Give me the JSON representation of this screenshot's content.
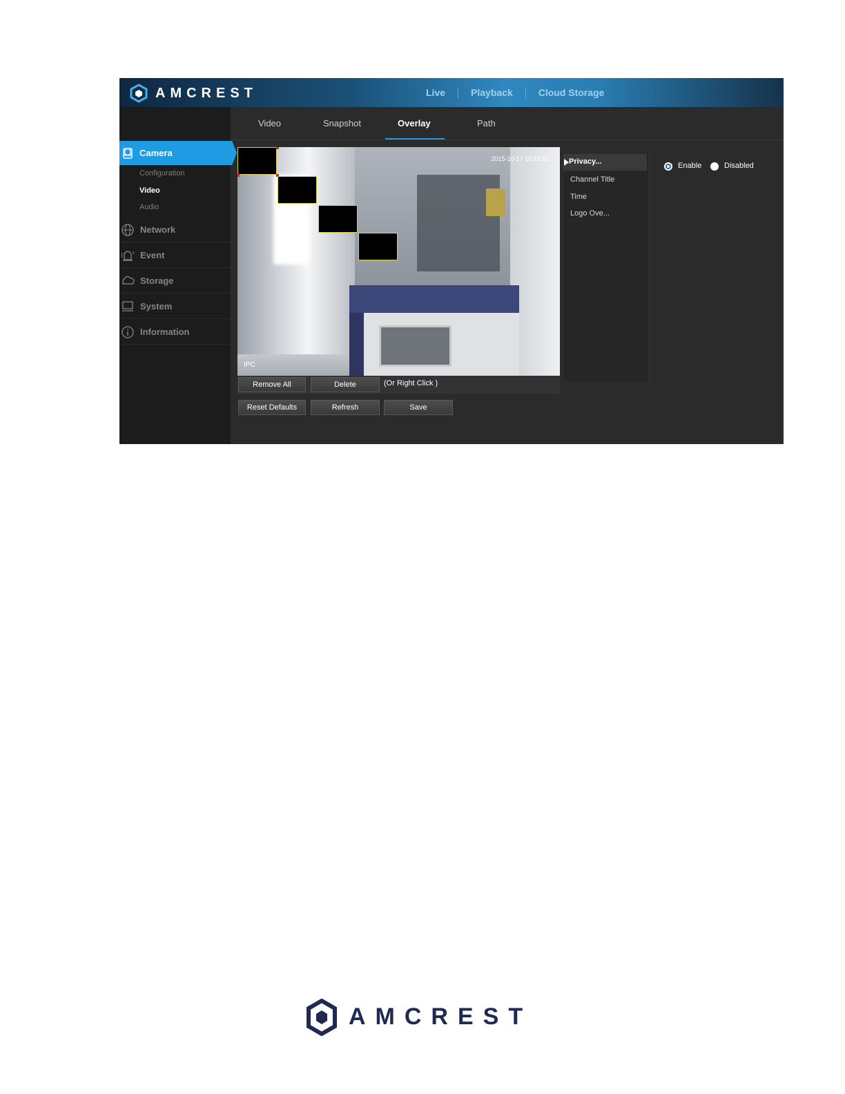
{
  "header": {
    "brand": "AMCREST",
    "nav": [
      "Live",
      "Playback",
      "Cloud Storage"
    ]
  },
  "sidebar": {
    "active": "Camera",
    "sub_items": [
      "Configuration",
      "Video",
      "Audio"
    ],
    "active_sub": "Video",
    "items": [
      "Network",
      "Event",
      "Storage",
      "System",
      "Information"
    ]
  },
  "tabs": [
    "Video",
    "Snapshot",
    "Overlay",
    "Path"
  ],
  "active_tab": "Overlay",
  "video": {
    "timestamp": "2015-10-17 10:22:31",
    "channel_label": "IPC"
  },
  "buttons": {
    "remove_all": "Remove All",
    "delete": "Delete",
    "hint": "(Or Right Click )",
    "reset_defaults": "Reset Defaults",
    "refresh": "Refresh",
    "save": "Save"
  },
  "overlay_menu": {
    "active": "Privacy...",
    "items": [
      "Channel Title",
      "Time",
      "Logo Ove..."
    ]
  },
  "privacy": {
    "enable_label": "Enable",
    "disabled_label": "Disabled",
    "selected": "Enable"
  },
  "footer": {
    "brand": "AMCREST"
  },
  "colors": {
    "accent": "#1e9be3",
    "brand_dark": "#1f2a52",
    "panel": "#2b2b2b"
  }
}
